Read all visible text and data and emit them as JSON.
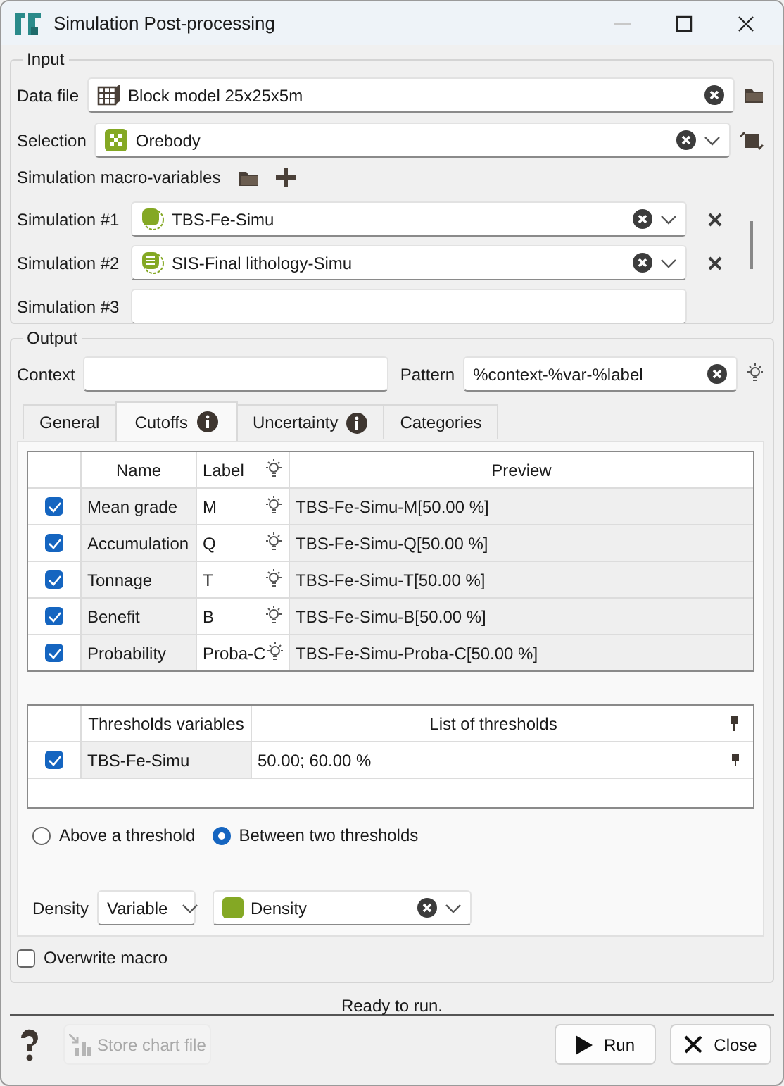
{
  "window": {
    "title": "Simulation Post-processing"
  },
  "input": {
    "title": "Input",
    "data_file": {
      "label": "Data file",
      "value": "Block model 25x25x5m"
    },
    "selection": {
      "label": "Selection",
      "value": "Orebody"
    },
    "macro_label": "Simulation macro-variables",
    "simulations": [
      {
        "label": "Simulation #1",
        "value": "TBS-Fe-Simu",
        "kind": "continuous"
      },
      {
        "label": "Simulation #2",
        "value": "SIS-Final lithology-Simu",
        "kind": "categorical"
      },
      {
        "label": "Simulation #3",
        "kind": "empty"
      }
    ]
  },
  "output": {
    "title": "Output",
    "context": {
      "label": "Context"
    },
    "pattern": {
      "label": "Pattern",
      "value": "%context-%var-%label"
    },
    "tabs": [
      {
        "label": "General",
        "selected": false,
        "info": false
      },
      {
        "label": "Cutoffs",
        "selected": true,
        "info": true
      },
      {
        "label": "Uncertainty",
        "selected": false,
        "info": true
      },
      {
        "label": "Categories",
        "selected": false,
        "info": false
      }
    ],
    "cutoffs": {
      "columns": [
        "Name",
        "Label",
        "Preview"
      ],
      "rows": [
        {
          "checked": true,
          "name": "Mean grade",
          "label": "M",
          "preview": "TBS-Fe-Simu-M[50.00 %]"
        },
        {
          "checked": true,
          "name": "Accumulation",
          "label": "Q",
          "preview": "TBS-Fe-Simu-Q[50.00 %]"
        },
        {
          "checked": true,
          "name": "Tonnage",
          "label": "T",
          "preview": "TBS-Fe-Simu-T[50.00 %]"
        },
        {
          "checked": true,
          "name": "Benefit",
          "label": "B",
          "preview": "TBS-Fe-Simu-B[50.00 %]"
        },
        {
          "checked": true,
          "name": "Probability",
          "label": "Proba-C",
          "preview": "TBS-Fe-Simu-Proba-C[50.00 %]"
        }
      ]
    },
    "thresholds": {
      "columns": [
        "Thresholds variables",
        "List of thresholds"
      ],
      "rows": [
        {
          "checked": true,
          "variable": "TBS-Fe-Simu",
          "thresholds": "50.00; 60.00 %"
        }
      ]
    },
    "modes": [
      {
        "label": "Above a threshold",
        "selected": false
      },
      {
        "label": "Between two thresholds",
        "selected": true
      }
    ],
    "density": {
      "label": "Density",
      "mode": "Variable",
      "value": "Density",
      "color": "#84a824"
    }
  },
  "overwrite": {
    "label": "Overwrite macro",
    "checked": false
  },
  "status": "Ready to run.",
  "buttons": {
    "store": {
      "label": "Store chart file",
      "disabled": true
    },
    "run": "Run",
    "close": "Close"
  }
}
